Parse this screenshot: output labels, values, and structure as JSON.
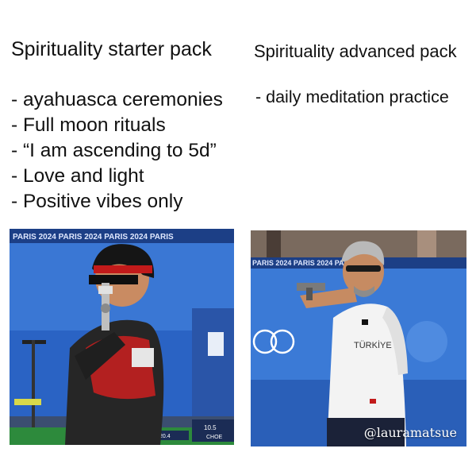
{
  "left": {
    "title": "Spirituality starter pack",
    "items": [
      "- ayahuasca ceremonies",
      "- Full moon rituals",
      "- “I am ascending to 5d”",
      "- Love and light",
      "- Positive vibes only"
    ],
    "photo": {
      "banner_text": "PARIS 2024  PARIS 2024  PARIS 2024  PARIS",
      "score_small": "20.4",
      "score_big": "10.5",
      "score_tag": "CHOE"
    }
  },
  "right": {
    "title": "Spirituality advanced pack",
    "items": [
      "- daily meditation practice"
    ],
    "photo": {
      "banner_text": "PARIS 2024  PARIS 2024  PARIS 2024",
      "shirt_text": "TÜRKİYE",
      "watermark": "@lauramatsue"
    }
  },
  "colors": {
    "arena_blue": "#1f5fbf",
    "banner_blue": "#1c3f86",
    "jacket_red": "#b32020",
    "text": "#111111"
  }
}
